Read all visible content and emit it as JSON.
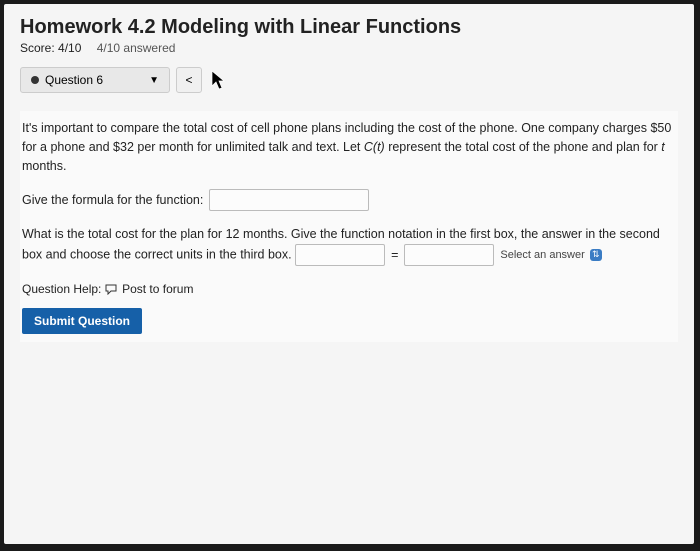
{
  "header": {
    "title": "Homework 4.2 Modeling with Linear Functions",
    "score_label": "Score: 4/10",
    "answered": "4/10 answered"
  },
  "nav": {
    "question_label": "Question 6",
    "prev": "<"
  },
  "problem": {
    "intro_a": "It's important to compare the total cost of cell phone plans including the cost of the phone. One company charges $50 for a phone and $32 per month for unlimited talk and text. Let ",
    "intro_fn": "C(t)",
    "intro_b": " represent the total cost of the phone and plan for ",
    "intro_var": "t",
    "intro_c": " months.",
    "formula_prompt": "Give the formula for the function:",
    "part2_a": "What is the total cost for the plan for 12 months. Give the function notation in the first box, the answer in the second box and choose the correct units in the third box.",
    "equals": "=",
    "select_label": "Select an answer",
    "help_label": "Question Help:",
    "post_forum": "Post to forum",
    "submit": "Submit Question"
  }
}
